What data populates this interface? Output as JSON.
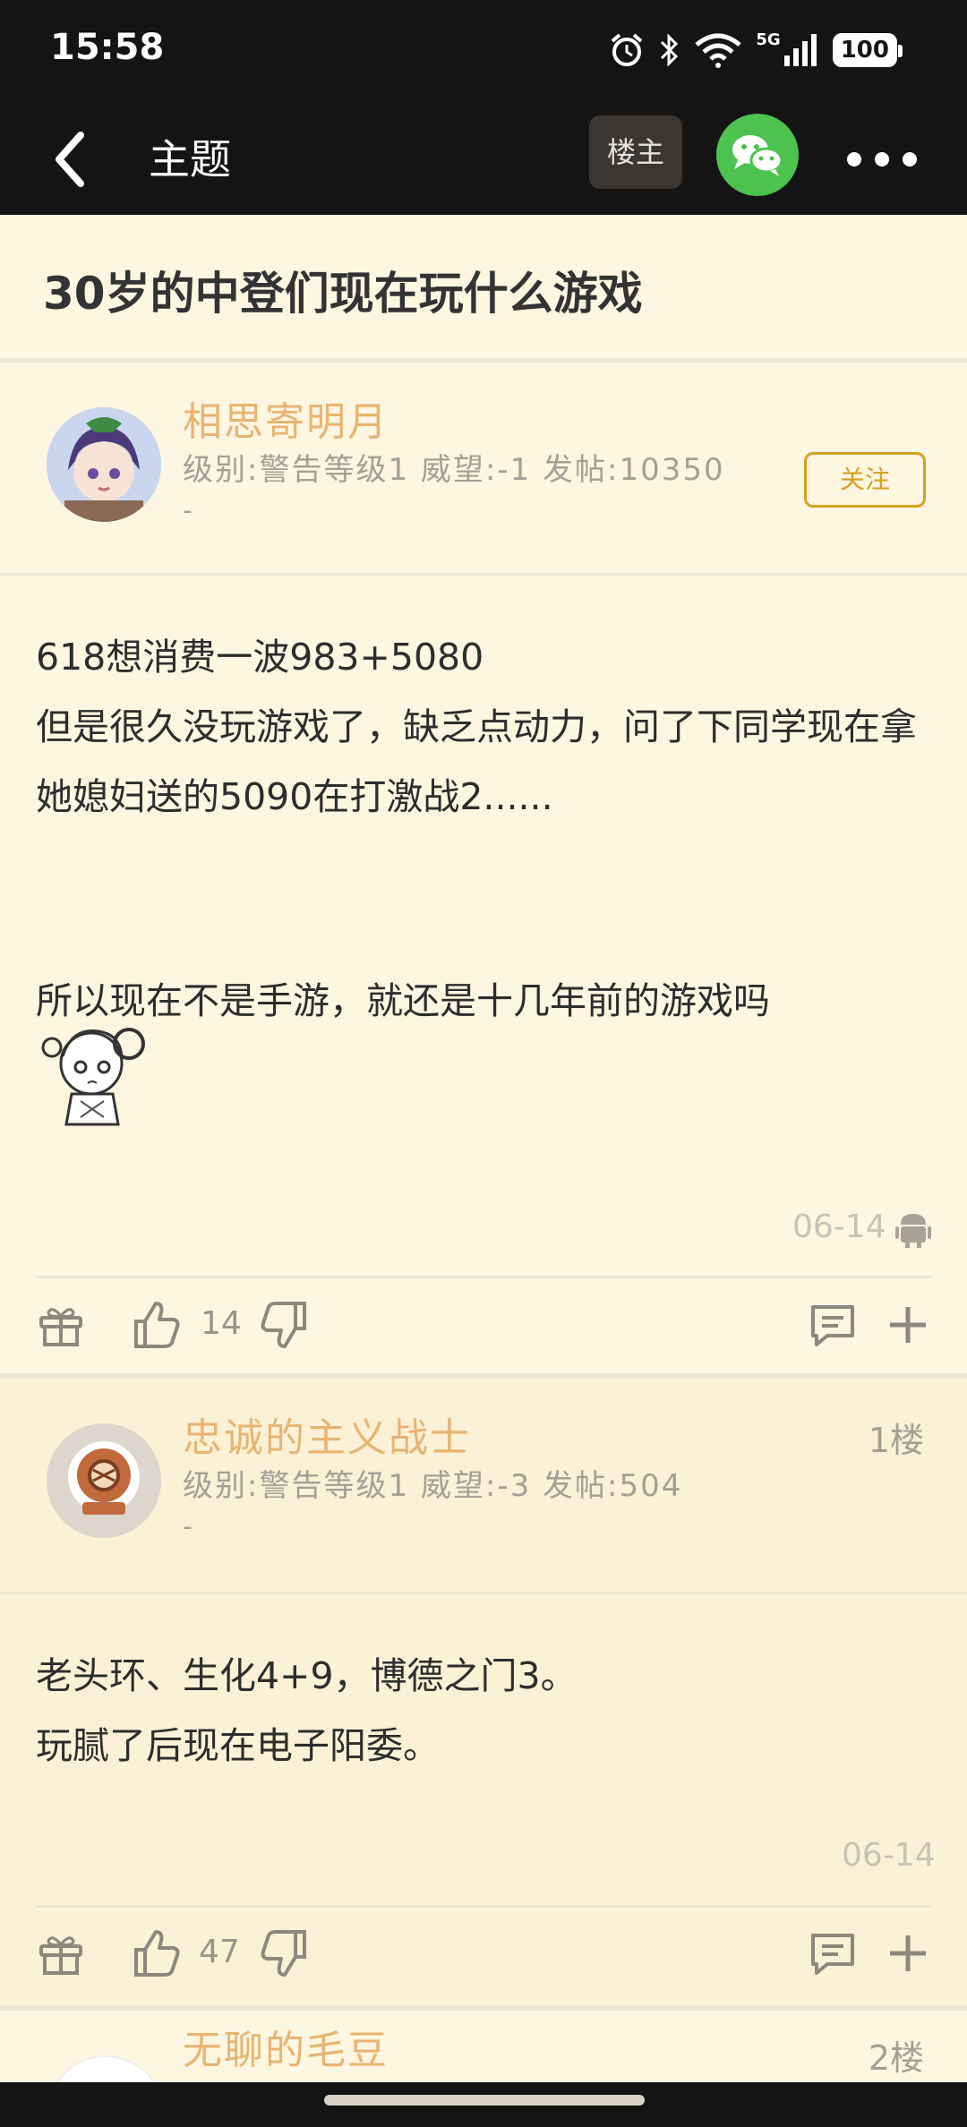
{
  "status_bar": {
    "time": "15:58",
    "network": "5G",
    "battery": "100",
    "icons": [
      "alarm-icon",
      "bluetooth-icon",
      "wifi-icon",
      "signal-icon",
      "battery-icon"
    ]
  },
  "nav": {
    "title": "主题",
    "owner_button": "楼主",
    "share_icon": "wechat-icon",
    "more_icon": "more-dots-icon",
    "back_icon": "back-chevron-icon"
  },
  "topic": {
    "title": "30岁的中登们现在玩什么游戏"
  },
  "posts": [
    {
      "username": "相思寄明月",
      "info": "级别:警告等级1 威望:-1 发帖:10350",
      "tag": "-",
      "follow_label": "关注",
      "content": [
        "618想消费一波983+5080",
        "但是很久没玩游戏了，缺乏点动力，问了下同学现在拿她媳妇送的5090在打激战2......",
        "",
        "所以现在不是手游，就还是十几年前的游戏吗"
      ],
      "date": "06-14",
      "likes": "14"
    },
    {
      "username": "忠诚的主义战士",
      "info": "级别:警告等级1 威望:-3 发帖:504",
      "tag": "-",
      "floor": "1楼",
      "content": [
        "老头环、生化4+9，博德之门3。",
        "玩腻了后现在电子阳委。"
      ],
      "date": "06-14",
      "likes": "47"
    },
    {
      "username": "无聊的毛豆",
      "floor": "2楼"
    }
  ],
  "colors": {
    "background": "#fdf6e1",
    "header": "#141414",
    "username": "#e8b472",
    "accent": "#d8a020",
    "wechat": "#4cc24f"
  }
}
